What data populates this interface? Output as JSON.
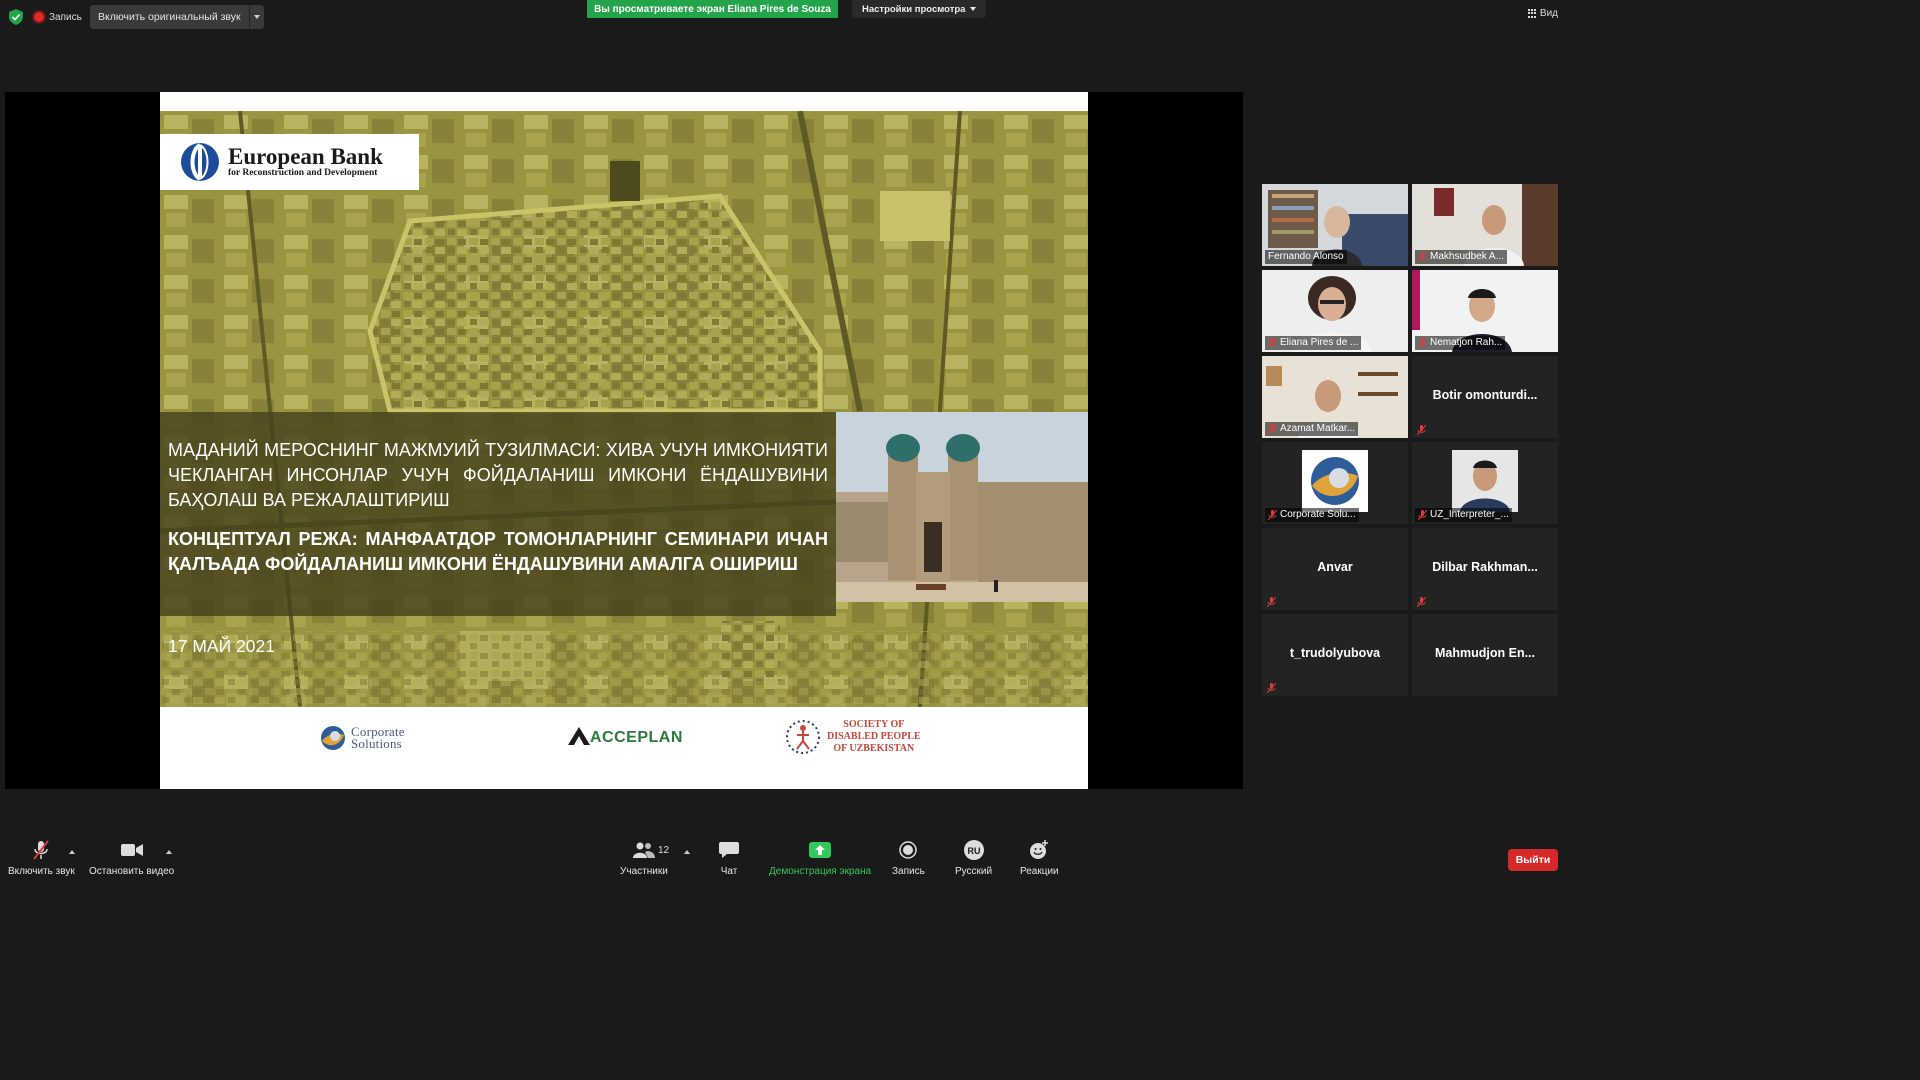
{
  "topbar": {
    "record_label": "Запись",
    "original_sound_label": "Включить оригинальный звук",
    "share_banner": "Вы просматриваете экран Eliana Pires de Souza",
    "view_settings_label": "Настройки просмотра",
    "view_label": "Вид"
  },
  "slide": {
    "logo_line1": "European Bank",
    "logo_line2": "for Reconstruction and Development",
    "title_1": "МАДАНИЙ МЕРОСНИНГ МАЖМУИЙ ТУЗИЛМАСИ: ХИВА УЧУН ИМКОНИЯТИ ЧЕКЛАНГАН ИНСОНЛАР УЧУН ФОЙДАЛАНИШ ИМКОНИ ЁНДАШУВИНИ БАҲОЛАШ ВА РЕЖАЛАШТИРИШ",
    "title_2": "КОНЦЕПТУАЛ РЕЖА: МАНФААТДОР ТОМОНЛАРНИНГ СЕМИНАРИ ИЧАН ҚАЛЪАДА ФОЙДАЛАНИШ ИМКОНИ ЁНДАШУВИНИ АМАЛГА ОШИРИШ",
    "date": "17 МАЙ 2021",
    "footer_logo_1_line1": "Corporate",
    "footer_logo_1_line2": "Solutions",
    "footer_logo_2": "ACCEPLAN",
    "footer_logo_3_line1": "SOCIETY OF",
    "footer_logo_3_line2": "DISABLED PEOPLE",
    "footer_logo_3_line3": "OF UZBEKISTAN"
  },
  "participants": [
    {
      "name": "Fernando Alonso",
      "video": true,
      "muted": false,
      "active": true
    },
    {
      "name": "Makhsudbek A...",
      "video": true,
      "muted": true,
      "active": false
    },
    {
      "name": "Eliana Pires de ...",
      "video": true,
      "muted": true,
      "active": false
    },
    {
      "name": "Nematjon Rah...",
      "video": true,
      "muted": true,
      "active": false
    },
    {
      "name": "Azamat Matkar...",
      "video": true,
      "muted": true,
      "active": false
    },
    {
      "name": "Botir  omonturdi...",
      "video": false,
      "muted": true,
      "active": false
    },
    {
      "name": "Corporate Solu...",
      "video": true,
      "muted": true,
      "active": false
    },
    {
      "name": "UZ_Interpreter_...",
      "video": true,
      "muted": true,
      "active": false
    },
    {
      "name": "Anvar",
      "video": false,
      "muted": true,
      "active": false
    },
    {
      "name": "Dilbar  Rakhman...",
      "video": false,
      "muted": true,
      "active": false
    },
    {
      "name": "t_trudolyubova",
      "video": false,
      "muted": true,
      "active": false
    },
    {
      "name": "Mahmudjon  En...",
      "video": false,
      "muted": false,
      "active": false
    }
  ],
  "toolbar": {
    "unmute_label": "Включить звук",
    "stop_video_label": "Остановить видео",
    "participants_label": "Участники",
    "participants_count": "12",
    "chat_label": "Чат",
    "share_label": "Демонстрация экрана",
    "record_label": "Запись",
    "language_label": "Русский",
    "language_code": "RU",
    "reactions_label": "Реакции",
    "leave_label": "Выйти"
  },
  "colors": {
    "share_green": "#23a44a",
    "active_speaker": "#e8e030",
    "leave_red": "#d62a2a",
    "mute_red": "#e03a3a"
  }
}
